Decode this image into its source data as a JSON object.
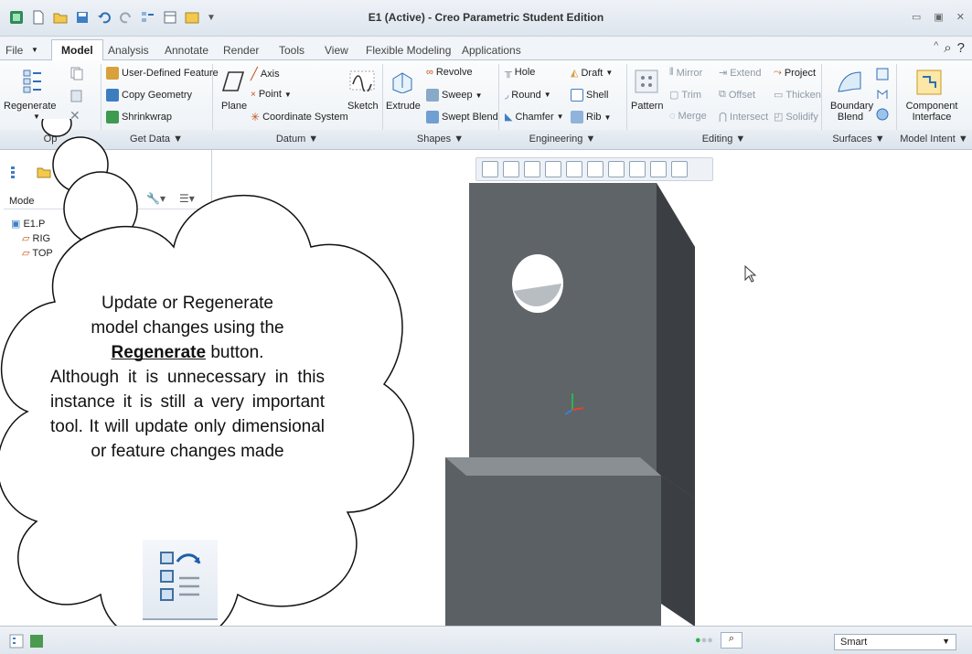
{
  "window": {
    "title": "E1 (Active) - Creo Parametric Student Edition"
  },
  "tabs": [
    "File",
    "Model",
    "Analysis",
    "Annotate",
    "Render",
    "Tools",
    "View",
    "Flexible Modeling",
    "Applications"
  ],
  "ribbon": {
    "operations": {
      "regenerate": "Regenerate"
    },
    "get_data": {
      "user_defined_feature": "User-Defined Feature",
      "copy_geometry": "Copy Geometry",
      "shrinkwrap": "Shrinkwrap"
    },
    "datum": {
      "plane": "Plane",
      "axis": "Axis",
      "point": "Point",
      "coordinate_system": "Coordinate System",
      "sketch": "Sketch"
    },
    "shapes": {
      "extrude": "Extrude",
      "revolve": "Revolve",
      "sweep": "Sweep",
      "swept_blend": "Swept Blend"
    },
    "engineering": {
      "hole": "Hole",
      "round": "Round",
      "chamfer": "Chamfer",
      "draft": "Draft",
      "shell": "Shell",
      "rib": "Rib"
    },
    "editing": {
      "pattern": "Pattern",
      "mirror": "Mirror",
      "trim": "Trim",
      "merge": "Merge",
      "extend": "Extend",
      "offset": "Offset",
      "intersect": "Intersect",
      "project": "Project",
      "thicken": "Thicken",
      "solidify": "Solidify"
    },
    "surfaces": {
      "boundary_blend": "Boundary Blend"
    },
    "model_intent": {
      "component_interface": "Component Interface"
    },
    "groups": {
      "operations": "Op",
      "get_data": "Get Data ▼",
      "datum": "Datum ▼",
      "shapes": "Shapes ▼",
      "engineering": "Engineering ▼",
      "editing": "Editing ▼",
      "surfaces": "Surfaces ▼",
      "model_intent": "Model Intent ▼"
    }
  },
  "model_tree": {
    "header": "Mode",
    "root": "E1.P",
    "items": [
      "RIG",
      "TOP"
    ]
  },
  "callout": {
    "line1": "Update or Regenerate",
    "line2": "model changes using the",
    "bold": "Regenerate",
    "rest": " button.",
    "paragraph": "Although it is unnecessary in this instance it is still a very important tool. It will update only dimensional or feature changes made"
  },
  "status": {
    "selection_filter": "Smart"
  },
  "colors": {
    "accent": "#2e6fb5",
    "part_face": "#5f6469",
    "part_dark": "#3b3f44"
  }
}
